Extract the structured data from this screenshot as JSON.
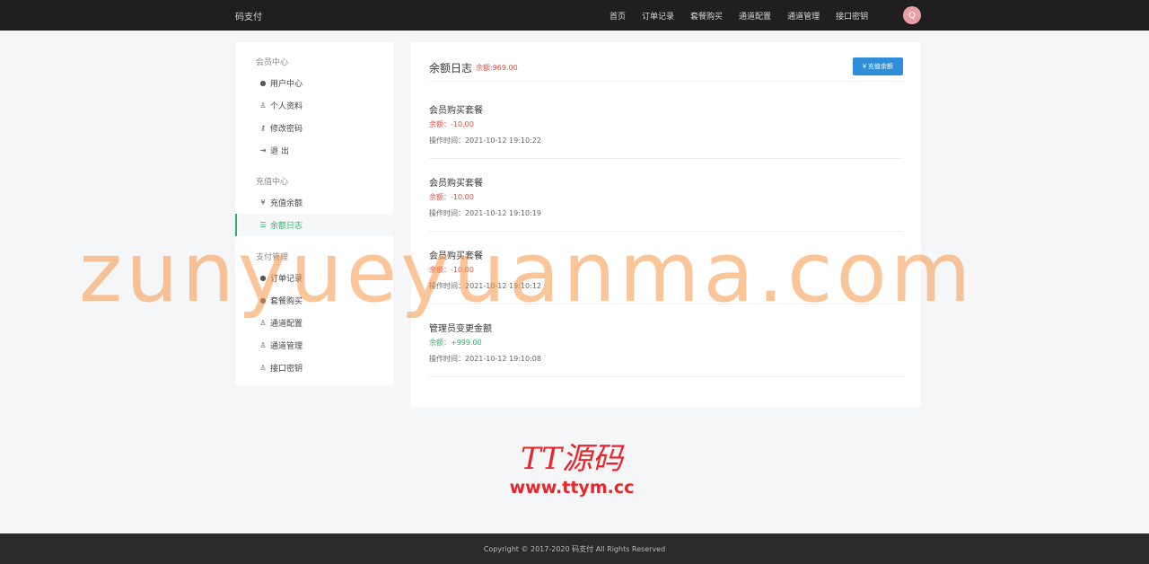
{
  "header": {
    "brand": "码支付",
    "nav": [
      "首页",
      "订单记录",
      "套餐购买",
      "通道配置",
      "通道管理",
      "接口密钥"
    ],
    "avatar": "Q"
  },
  "sidebar": {
    "sections": [
      {
        "title": "会员中心",
        "items": [
          {
            "label": "用户中心",
            "icon": "user-circle-icon",
            "glyph": "●"
          },
          {
            "label": "个人资料",
            "icon": "user-icon",
            "glyph": "♙"
          },
          {
            "label": "修改密码",
            "icon": "key-icon",
            "glyph": "⚷"
          },
          {
            "label": "退 出",
            "icon": "logout-icon",
            "glyph": "⇥"
          }
        ]
      },
      {
        "title": "充值中心",
        "items": [
          {
            "label": "充值余额",
            "icon": "yen-icon",
            "glyph": "¥"
          },
          {
            "label": "余额日志",
            "icon": "list-icon",
            "glyph": "☰",
            "active": true
          }
        ]
      },
      {
        "title": "支付管理",
        "items": [
          {
            "label": "订单记录",
            "icon": "user-circle-icon",
            "glyph": "●"
          },
          {
            "label": "套餐购买",
            "icon": "user-circle-icon",
            "glyph": "●"
          },
          {
            "label": "通道配置",
            "icon": "user-icon",
            "glyph": "♙"
          },
          {
            "label": "通道管理",
            "icon": "user-icon",
            "glyph": "♙"
          },
          {
            "label": "接口密钥",
            "icon": "user-icon",
            "glyph": "♙"
          }
        ]
      }
    ]
  },
  "main": {
    "title": "余额日志",
    "balance": "余额:969.00",
    "recharge_label": "¥ 充值余额",
    "logs": [
      {
        "title": "会员购买套餐",
        "amount": "余额：-10.00",
        "type": "neg",
        "time": "操作时间：2021-10-12 19:10:22"
      },
      {
        "title": "会员购买套餐",
        "amount": "余额：-10.00",
        "type": "neg",
        "time": "操作时间：2021-10-12 19:10:19"
      },
      {
        "title": "会员购买套餐",
        "amount": "余额：-10.00",
        "type": "neg",
        "time": "操作时间：2021-10-12 19:10:12"
      },
      {
        "title": "管理员变更金额",
        "amount": "余额：+999.00",
        "type": "pos",
        "time": "操作时间：2021-10-12 19:10:08"
      }
    ]
  },
  "watermark": "zunyueyuanma.com",
  "logo": {
    "main": "TT源码",
    "url": "www.ttym.cc"
  },
  "footer": "Copyright © 2017-2020 码支付 All Rights Reserved",
  "colors": {
    "accent": "#2fb36d",
    "negative": "#e74c3c",
    "button": "#2e8ed9"
  }
}
